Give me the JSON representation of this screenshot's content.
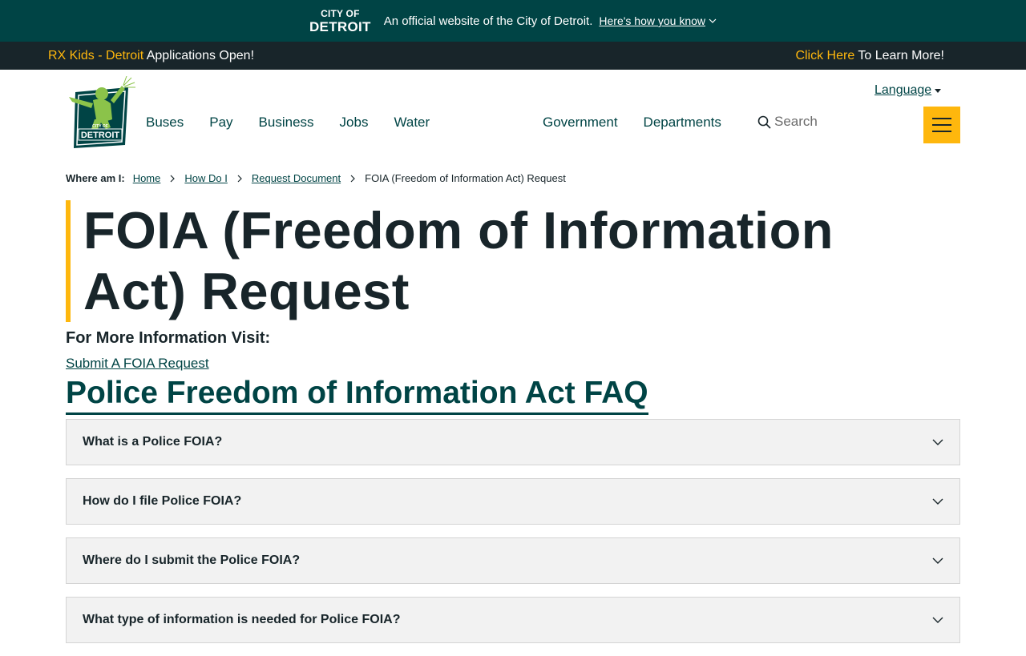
{
  "official": {
    "logo_small": "CITY OF",
    "logo_big": "DETROIT",
    "text": "An official website of the City of Detroit.",
    "link": "Here's how you know"
  },
  "announcement": {
    "left_highlight": "RX Kids - Detroit",
    "left_rest": " Applications Open!",
    "right_highlight": "Click Here",
    "right_rest": " To Learn More!"
  },
  "header": {
    "language_label": "Language",
    "nav_left": [
      "Buses",
      "Pay",
      "Business",
      "Jobs",
      "Water"
    ],
    "nav_right": [
      "Government",
      "Departments"
    ],
    "search_placeholder": "Search",
    "logo_text_small": "CITY OF",
    "logo_text_big": "DETROIT"
  },
  "breadcrumb": {
    "label": "Where am I:",
    "items": [
      "Home",
      "How Do I",
      "Request Document"
    ],
    "current": "FOIA (Freedom of Information Act) Request"
  },
  "page": {
    "title": "FOIA (Freedom of Information Act) Request",
    "more_info": "For More Information Visit:",
    "foia_link": "Submit A FOIA Request",
    "faq_heading": "Police Freedom of Information Act FAQ"
  },
  "faq": [
    "What is a Police FOIA?",
    "How do I file Police FOIA?",
    "Where do I submit the Police FOIA?",
    "What type of information is needed for Police FOIA?"
  ],
  "colors": {
    "brand_green": "#004445",
    "accent_yellow": "#feb70d",
    "dark": "#18252a"
  }
}
